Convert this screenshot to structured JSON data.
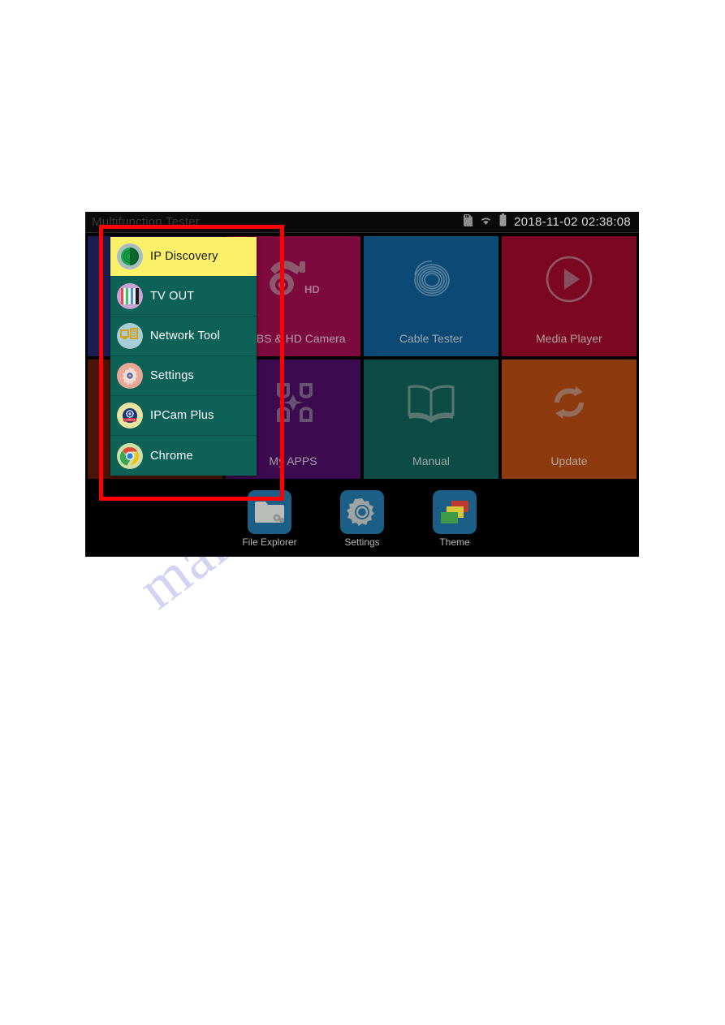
{
  "page": {
    "watermark": "manualslive.com"
  },
  "screen": {
    "status_bar": {
      "app_title": "Multifunction Tester",
      "clock": "2018-11-02 02:38:08",
      "icons": [
        "sdcard-icon",
        "wifi-icon",
        "battery-icon"
      ]
    },
    "tiles": [
      {
        "label": "",
        "icon": "blank-icon",
        "color": "#191d52",
        "hidden_behind_menu": true
      },
      {
        "label": "CVBS & HD Camera",
        "icon": "dome-camera-icon",
        "color": "#7d0a3c"
      },
      {
        "label": "Cable Tester",
        "icon": "cable-coil-icon",
        "color": "#0c4a75"
      },
      {
        "label": "Media Player",
        "icon": "play-circle-icon",
        "color": "#7b0723"
      },
      {
        "label": "",
        "icon": "blank-icon",
        "color": "#4a1407",
        "hidden_behind_menu": true
      },
      {
        "label": "My APPS",
        "icon": "apps-grid-icon",
        "color": "#3c0a4f"
      },
      {
        "label": "Manual",
        "icon": "open-book-icon",
        "color": "#0c4c45"
      },
      {
        "label": "Update",
        "icon": "refresh-sync-icon",
        "color": "#8d3a0e"
      }
    ],
    "dock": [
      {
        "label": "File Explorer",
        "icon": "folder-gear-icon"
      },
      {
        "label": "Settings",
        "icon": "gear-icon"
      },
      {
        "label": "Theme",
        "icon": "theme-cards-icon"
      }
    ],
    "popup_menu": {
      "items": [
        {
          "label": "IP Discovery",
          "icon": "ip-discovery-icon",
          "selected": true
        },
        {
          "label": "TV OUT",
          "icon": "tv-out-icon",
          "selected": false
        },
        {
          "label": "Network Tool",
          "icon": "network-tool-icon",
          "selected": false
        },
        {
          "label": "Settings",
          "icon": "settings-gear-icon",
          "selected": false
        },
        {
          "label": "IPCam Plus",
          "icon": "ipcam-plus-icon",
          "selected": false
        },
        {
          "label": "Chrome",
          "icon": "chrome-icon",
          "selected": false
        }
      ]
    },
    "annotation": {
      "color": "#ff0000",
      "shape": "rectangle"
    }
  }
}
